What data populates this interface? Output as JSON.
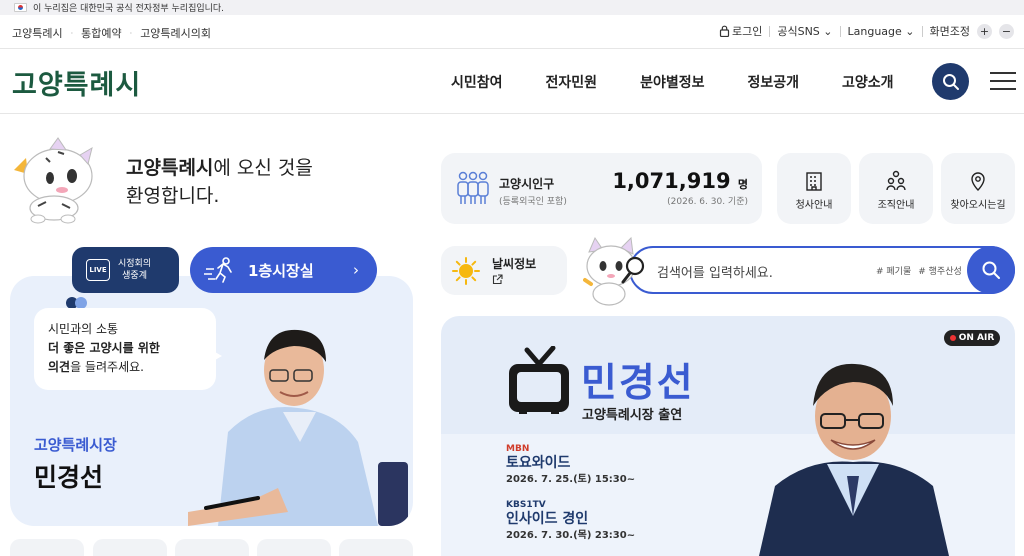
{
  "gov_bar": {
    "text": "이 누리집은 대한민국 공식 전자정부 누리집입니다."
  },
  "util": {
    "crumbs": [
      "고양특례시",
      "통합예약",
      "고양특례시의회"
    ],
    "login": "로그인",
    "sns": "공식SNS",
    "language": "Language",
    "zoom": "화면조정",
    "zoom_in": "+",
    "zoom_out": "−"
  },
  "header": {
    "logo": "고양특례시",
    "nav": [
      "시민참여",
      "전자민원",
      "분야별정보",
      "정보공개",
      "고양소개"
    ]
  },
  "welcome": {
    "bold": "고양특례시",
    "rest": "에 오신 것을",
    "line2": "환영합니다."
  },
  "live": {
    "line1": "시정회의",
    "line2": "생중계",
    "icon_text": "LIVE"
  },
  "room": {
    "label": "1층시장실",
    "arrow": "›"
  },
  "mayor": {
    "bubble1": "시민과의 소통",
    "bubble2": "더 좋은 고양시를 위한",
    "bubble3_bold": "의견",
    "bubble3_rest": "을 들려주세요.",
    "role": "고양특례시장",
    "name": "민경선"
  },
  "population": {
    "label": "고양시인구",
    "sub": "(등록외국인 포함)",
    "value": "1,071,919",
    "unit": "명",
    "date": "(2026. 6. 30. 기준)"
  },
  "services": [
    {
      "label": "청사안내",
      "icon": "building-icon"
    },
    {
      "label": "조직안내",
      "icon": "people-icon"
    },
    {
      "label": "찾아오시는길",
      "icon": "location-pin-icon"
    }
  ],
  "weather": {
    "label": "날씨정보"
  },
  "search": {
    "placeholder": "검색어를 입력하세요.",
    "tags": [
      "# 폐기물",
      "# 행주산성"
    ]
  },
  "banner": {
    "onair": "ON AIR",
    "name": "민경선",
    "subtitle": "고양특례시장 출연",
    "schedule": [
      {
        "channel": "MBN",
        "program": "토요와이드",
        "time": "2026. 7. 25.(토) 15:30~"
      },
      {
        "channel": "KBS1TV",
        "program": "인사이드 경인",
        "time": "2026. 7. 30.(목) 23:30~"
      }
    ]
  },
  "colors": {
    "brand_green": "#1c5a40",
    "navy": "#1f3a6d",
    "accent_blue": "#3a5bd1"
  }
}
